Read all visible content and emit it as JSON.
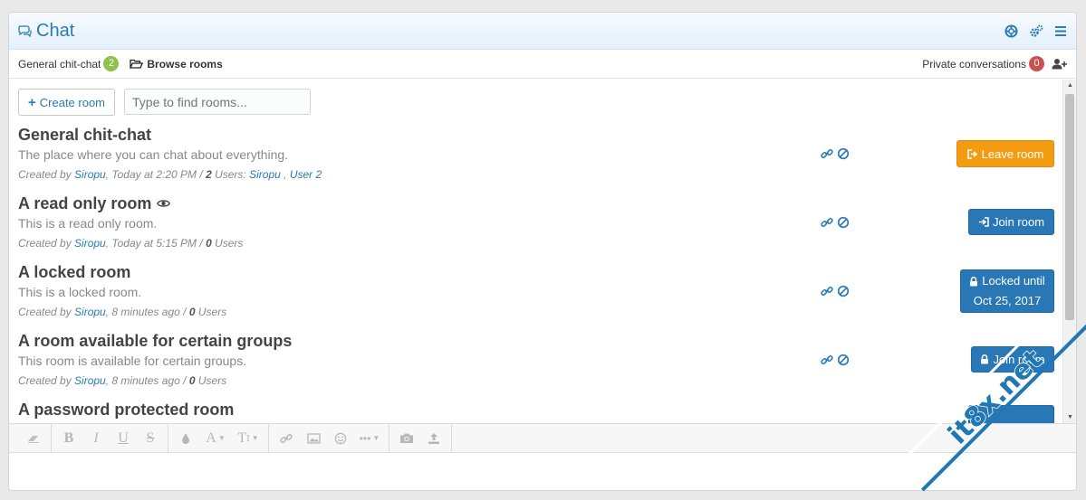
{
  "header": {
    "title": "Chat"
  },
  "tabs": {
    "general": {
      "label": "General chit-chat",
      "count": "2"
    },
    "browse": {
      "label": "Browse rooms"
    },
    "private": {
      "label": "Private conversations",
      "count": "0"
    }
  },
  "toolbar": {
    "create_label": "Create room",
    "search_placeholder": "Type to find rooms..."
  },
  "rooms": [
    {
      "name": "General chit-chat",
      "desc": "The place where you can chat about everything.",
      "author": "Siropu",
      "time": "Today at 2:20 PM",
      "users": "2",
      "users_label": "Users:",
      "user_list": [
        "Siropu",
        "User 2"
      ],
      "action": "Leave room"
    },
    {
      "name": "A read only room",
      "desc": "This is a read only room.",
      "author": "Siropu",
      "time": "Today at 5:15 PM",
      "users": "0",
      "users_label": "Users",
      "action": "Join room"
    },
    {
      "name": "A locked room",
      "desc": "This is a locked room.",
      "author": "Siropu",
      "time": "8 minutes ago",
      "users": "0",
      "users_label": "Users",
      "action_line1": "Locked until",
      "action_line2": "Oct 25, 2017"
    },
    {
      "name": "A room available for certain groups",
      "desc": "This room is available for certain groups.",
      "author": "Siropu",
      "time": "8 minutes ago",
      "users": "0",
      "users_label": "Users",
      "action": "Join room"
    },
    {
      "name": "A password protected room"
    }
  ],
  "meta_labels": {
    "created_by": "Created by",
    "sep": "/"
  },
  "watermark": {
    "text": "it8x.net"
  },
  "colors": {
    "accent": "#2a7ab8",
    "leave": "#f39c12",
    "join": "#2a77b6",
    "badge_green": "#8cc14c",
    "badge_red": "#c9524f"
  }
}
